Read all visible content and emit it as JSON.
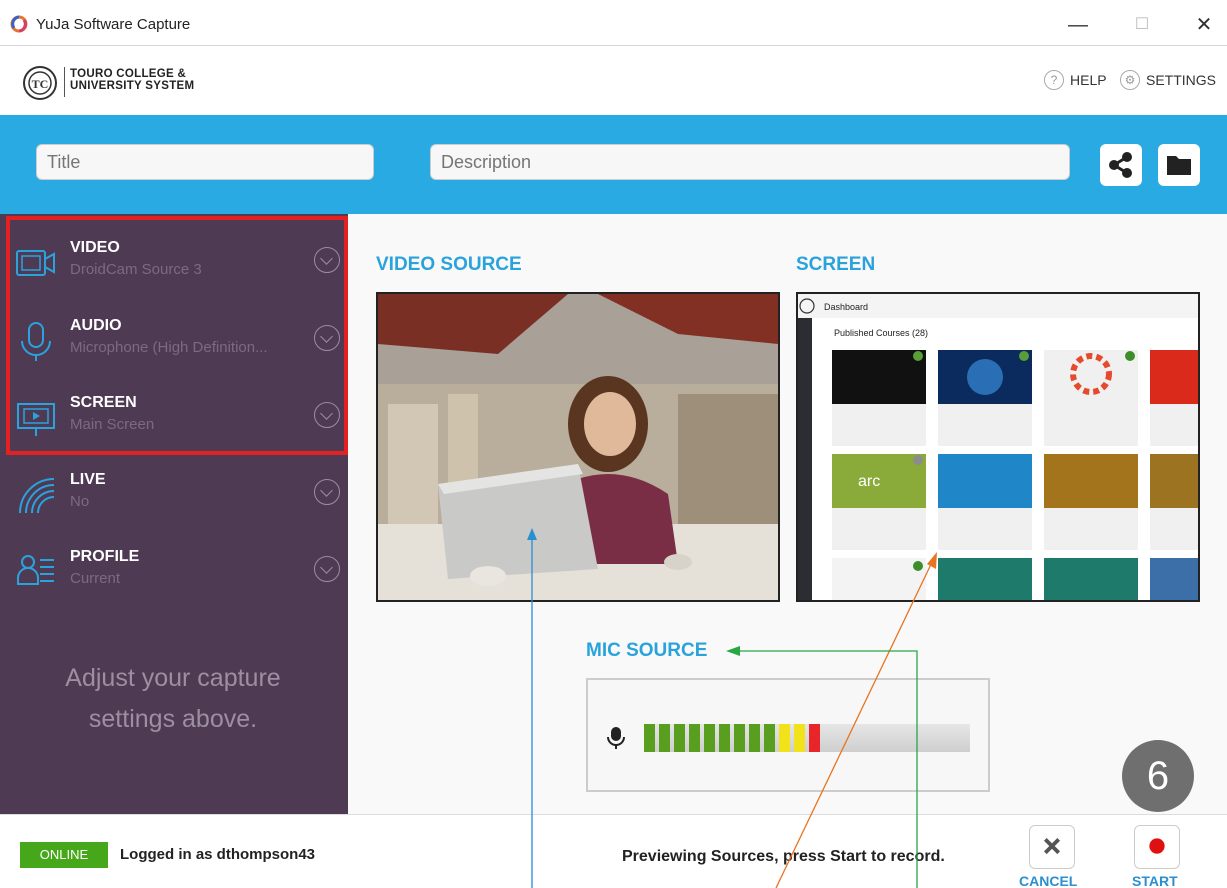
{
  "window": {
    "title": "YuJa Software Capture",
    "minimize": "—",
    "maximize": "☐",
    "close": "✕"
  },
  "header": {
    "logo_line1": "TOURO COLLEGE &",
    "logo_line2": "UNIVERSITY SYSTEM",
    "help_label": "HELP",
    "settings_label": "SETTINGS"
  },
  "band": {
    "title_placeholder": "Title",
    "description_placeholder": "Description"
  },
  "sidebar": {
    "items": [
      {
        "label": "VIDEO",
        "value": "DroidCam Source 3",
        "icon": "video-camera-icon"
      },
      {
        "label": "AUDIO",
        "value": "Microphone (High Definition...",
        "icon": "microphone-icon"
      },
      {
        "label": "SCREEN",
        "value": "Main Screen",
        "icon": "screen-icon"
      },
      {
        "label": "LIVE",
        "value": "No",
        "icon": "live-broadcast-icon"
      },
      {
        "label": "PROFILE",
        "value": "Current",
        "icon": "profile-icon"
      }
    ],
    "hint": "Adjust your capture settings above."
  },
  "main": {
    "video_source_title": "VIDEO SOURCE",
    "screen_title": "SCREEN",
    "mic_source_title": "MIC SOURCE",
    "mic_level_segments_active": 12,
    "mic_level_segments_green": 9,
    "mic_level_segments_yellow": 2,
    "mic_level_segments_red": 1
  },
  "screen_preview": {
    "app_title": "Dashboard",
    "section": "Published Courses (28)",
    "arc_label": "arc"
  },
  "footer": {
    "online_badge": "ONLINE",
    "logged_in": "Logged in as dthompson43",
    "status": "Previewing Sources, press Start to record.",
    "cancel_label": "CANCEL",
    "start_label": "START"
  },
  "step_badge": "6",
  "colors": {
    "accent_blue": "#2aaae3",
    "sidebar_purple": "#4f3a54",
    "highlight_red": "#e32120",
    "online_green": "#47a71a",
    "section_title_blue": "#2aa3dd"
  }
}
